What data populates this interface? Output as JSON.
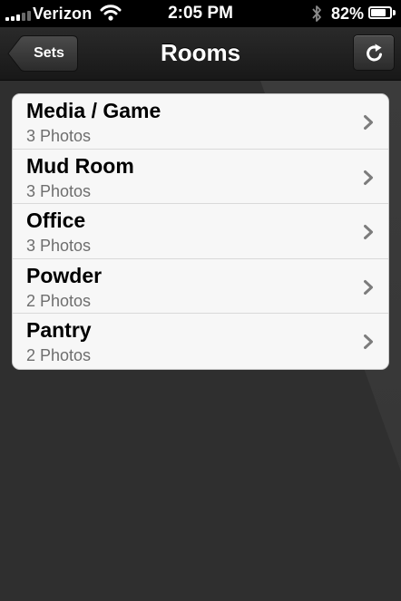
{
  "status_bar": {
    "carrier": "Verizon",
    "time": "2:05 PM",
    "battery_percent_label": "82%",
    "battery_level": 0.82
  },
  "nav": {
    "back_label": "Sets",
    "title": "Rooms",
    "refresh_icon": "refresh-icon"
  },
  "rooms": [
    {
      "name": "Media / Game",
      "subtitle": "3 Photos"
    },
    {
      "name": "Mud Room",
      "subtitle": "3 Photos"
    },
    {
      "name": "Office",
      "subtitle": "3 Photos"
    },
    {
      "name": "Powder",
      "subtitle": "2 Photos"
    },
    {
      "name": "Pantry",
      "subtitle": "2 Photos"
    }
  ],
  "colors": {
    "background": "#2f2f2f",
    "nav_bar": "#1f1f1f",
    "list_bg": "#f7f7f7",
    "subtitle": "#6e6e6e"
  }
}
